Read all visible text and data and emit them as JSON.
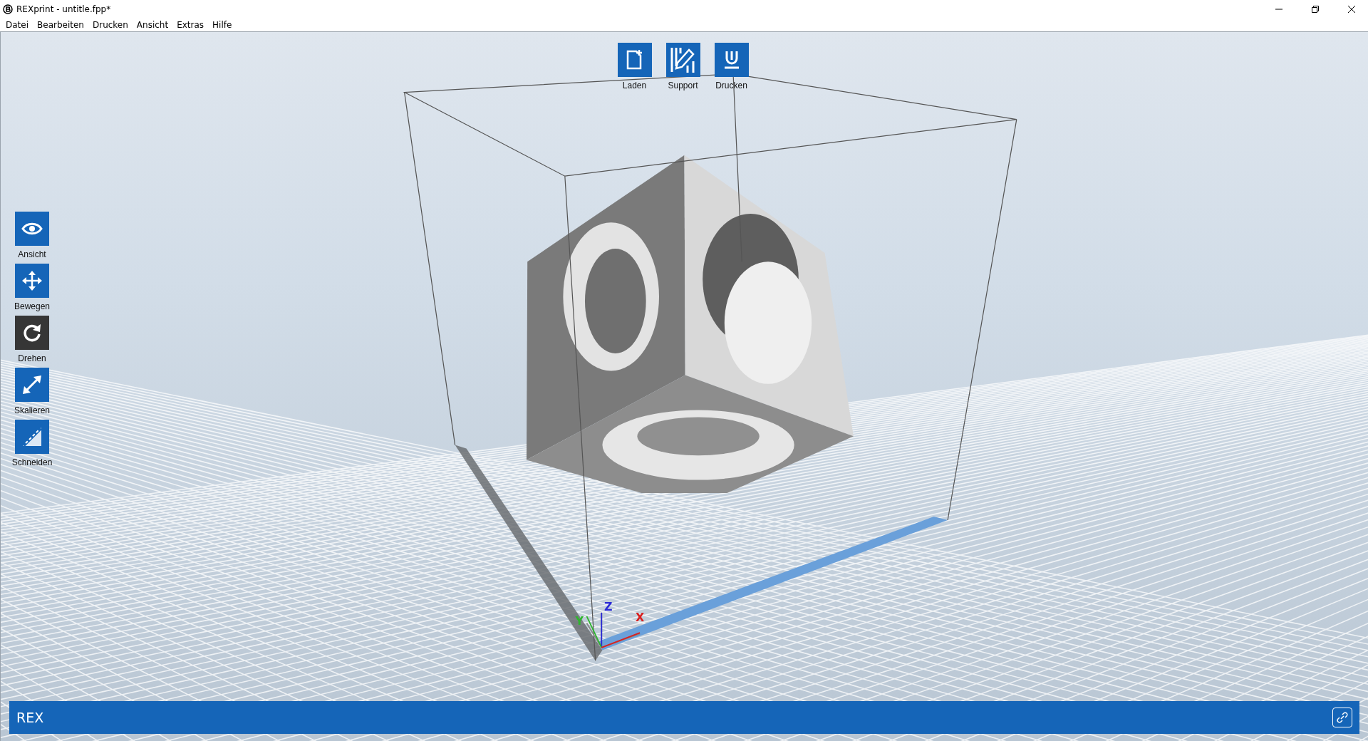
{
  "window": {
    "title": "REXprint - untitle.fpp*"
  },
  "menu": [
    "Datei",
    "Bearbeiten",
    "Drucken",
    "Ansicht",
    "Extras",
    "Hilfe"
  ],
  "top_toolbar": [
    {
      "label": "Laden"
    },
    {
      "label": "Support"
    },
    {
      "label": "Drucken"
    }
  ],
  "left_toolbar": [
    {
      "label": "Ansicht",
      "selected": false
    },
    {
      "label": "Bewegen",
      "selected": false
    },
    {
      "label": "Drehen",
      "selected": true
    },
    {
      "label": "Skalieren",
      "selected": false
    },
    {
      "label": "Schneiden",
      "selected": false
    }
  ],
  "axes": [
    {
      "label": "Z",
      "color": "#2a2ad6"
    },
    {
      "label": "Y",
      "color": "#2fb52f"
    },
    {
      "label": "X",
      "color": "#d82020"
    }
  ],
  "status_bar": {
    "text": "REX"
  }
}
